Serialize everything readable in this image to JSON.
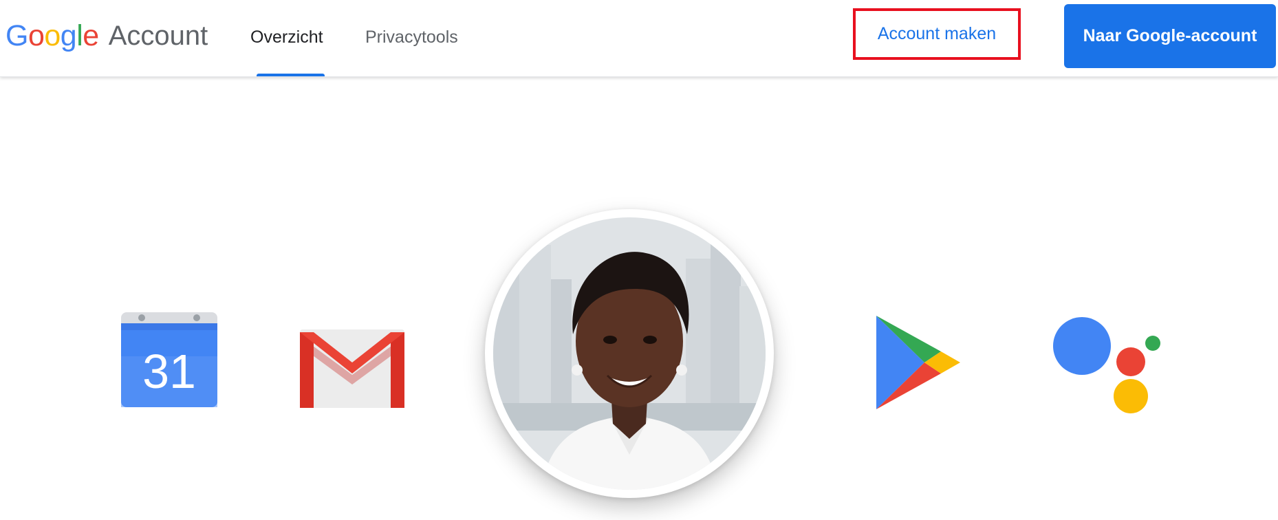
{
  "header": {
    "logo_letters": [
      {
        "char": "G",
        "color": "#4285F4"
      },
      {
        "char": "o",
        "color": "#EA4335"
      },
      {
        "char": "o",
        "color": "#FBBC05"
      },
      {
        "char": "g",
        "color": "#4285F4"
      },
      {
        "char": "l",
        "color": "#34A853"
      },
      {
        "char": "e",
        "color": "#EA4335"
      }
    ],
    "product_name": "Account",
    "tabs": [
      {
        "label": "Overzicht",
        "active": true
      },
      {
        "label": "Privacytools",
        "active": false
      }
    ],
    "create_account_label": "Account maken",
    "go_to_account_label": "Naar Google-account"
  },
  "hero": {
    "apps": [
      {
        "icon": "calendar-icon",
        "label": "31"
      },
      {
        "icon": "gmail-icon"
      },
      {
        "icon": "avatar-photo"
      },
      {
        "icon": "play-store-icon"
      },
      {
        "icon": "assistant-icon"
      }
    ]
  },
  "colors": {
    "accent": "#1a73e8",
    "highlight_border": "#e8101f",
    "text_primary": "#202124",
    "text_secondary": "#5f6368"
  }
}
